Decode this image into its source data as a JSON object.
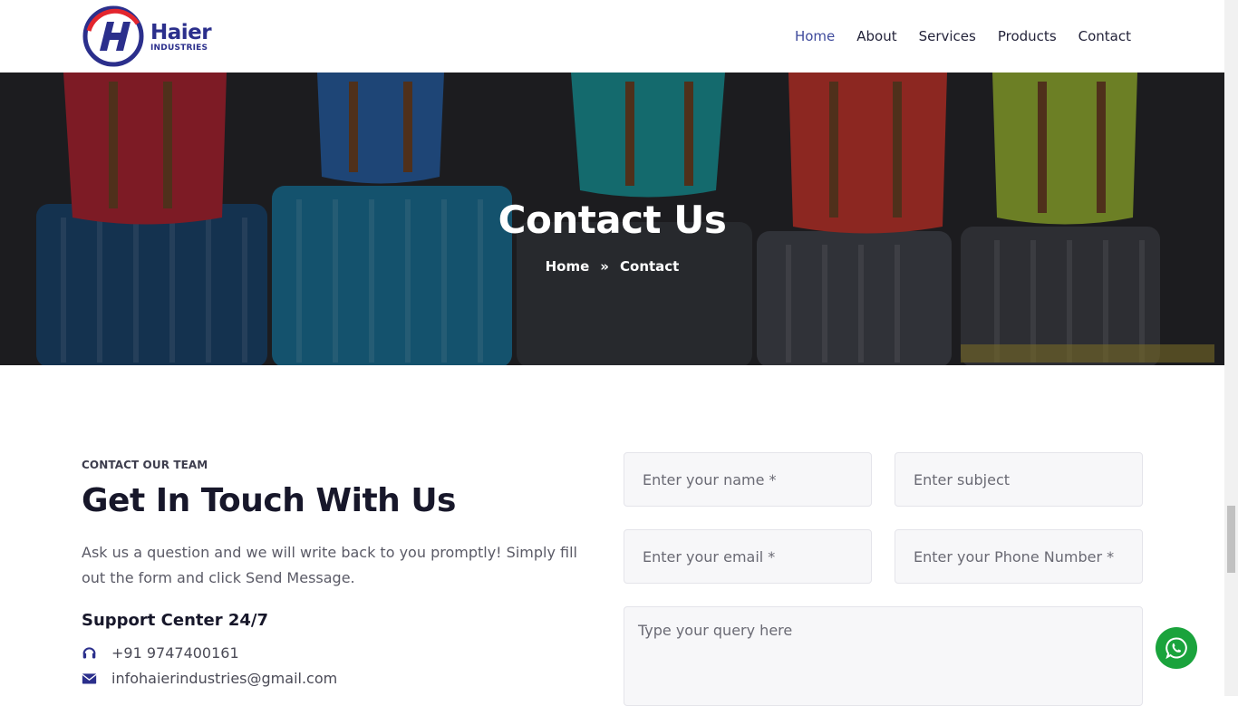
{
  "brand": {
    "name": "Haier",
    "subtitle": "INDUSTRIES",
    "primary_color": "#2b2f8c",
    "accent_color": "#e3262e"
  },
  "nav": {
    "items": [
      {
        "label": "Home",
        "active": true
      },
      {
        "label": "About",
        "active": false
      },
      {
        "label": "Services",
        "active": false
      },
      {
        "label": "Products",
        "active": false
      },
      {
        "label": "Contact",
        "active": false
      }
    ]
  },
  "hero": {
    "title": "Contact Us",
    "breadcrumb": {
      "home": "Home",
      "separator": "»",
      "current": "Contact"
    }
  },
  "contact": {
    "eyebrow": "CONTACT OUR TEAM",
    "title": "Get In Touch With Us",
    "lead": "Ask us a question and we will write back to you promptly! Simply fill out the form and click Send Message.",
    "support_title": "Support Center 24/7",
    "phone": "+91 9747400161",
    "email": "infohaierindustries@gmail.com",
    "phone_icon": "headset-icon",
    "email_icon": "envelope-icon"
  },
  "form": {
    "name_placeholder": "Enter your name *",
    "subject_placeholder": "Enter subject",
    "email_placeholder": "Enter your email *",
    "phone_placeholder": "Enter your Phone Number *",
    "query_placeholder": "Type your query here"
  },
  "whatsapp": {
    "icon": "whatsapp-icon",
    "color": "#1aa33c"
  }
}
